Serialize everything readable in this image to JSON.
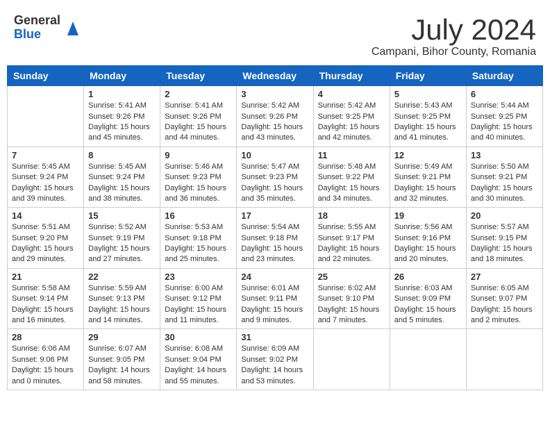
{
  "header": {
    "logo_general": "General",
    "logo_blue": "Blue",
    "month_title": "July 2024",
    "location": "Campani, Bihor County, Romania"
  },
  "days_of_week": [
    "Sunday",
    "Monday",
    "Tuesday",
    "Wednesday",
    "Thursday",
    "Friday",
    "Saturday"
  ],
  "weeks": [
    [
      {
        "day": "",
        "info": ""
      },
      {
        "day": "1",
        "info": "Sunrise: 5:41 AM\nSunset: 9:26 PM\nDaylight: 15 hours\nand 45 minutes."
      },
      {
        "day": "2",
        "info": "Sunrise: 5:41 AM\nSunset: 9:26 PM\nDaylight: 15 hours\nand 44 minutes."
      },
      {
        "day": "3",
        "info": "Sunrise: 5:42 AM\nSunset: 9:26 PM\nDaylight: 15 hours\nand 43 minutes."
      },
      {
        "day": "4",
        "info": "Sunrise: 5:42 AM\nSunset: 9:25 PM\nDaylight: 15 hours\nand 42 minutes."
      },
      {
        "day": "5",
        "info": "Sunrise: 5:43 AM\nSunset: 9:25 PM\nDaylight: 15 hours\nand 41 minutes."
      },
      {
        "day": "6",
        "info": "Sunrise: 5:44 AM\nSunset: 9:25 PM\nDaylight: 15 hours\nand 40 minutes."
      }
    ],
    [
      {
        "day": "7",
        "info": "Sunrise: 5:45 AM\nSunset: 9:24 PM\nDaylight: 15 hours\nand 39 minutes."
      },
      {
        "day": "8",
        "info": "Sunrise: 5:45 AM\nSunset: 9:24 PM\nDaylight: 15 hours\nand 38 minutes."
      },
      {
        "day": "9",
        "info": "Sunrise: 5:46 AM\nSunset: 9:23 PM\nDaylight: 15 hours\nand 36 minutes."
      },
      {
        "day": "10",
        "info": "Sunrise: 5:47 AM\nSunset: 9:23 PM\nDaylight: 15 hours\nand 35 minutes."
      },
      {
        "day": "11",
        "info": "Sunrise: 5:48 AM\nSunset: 9:22 PM\nDaylight: 15 hours\nand 34 minutes."
      },
      {
        "day": "12",
        "info": "Sunrise: 5:49 AM\nSunset: 9:21 PM\nDaylight: 15 hours\nand 32 minutes."
      },
      {
        "day": "13",
        "info": "Sunrise: 5:50 AM\nSunset: 9:21 PM\nDaylight: 15 hours\nand 30 minutes."
      }
    ],
    [
      {
        "day": "14",
        "info": "Sunrise: 5:51 AM\nSunset: 9:20 PM\nDaylight: 15 hours\nand 29 minutes."
      },
      {
        "day": "15",
        "info": "Sunrise: 5:52 AM\nSunset: 9:19 PM\nDaylight: 15 hours\nand 27 minutes."
      },
      {
        "day": "16",
        "info": "Sunrise: 5:53 AM\nSunset: 9:18 PM\nDaylight: 15 hours\nand 25 minutes."
      },
      {
        "day": "17",
        "info": "Sunrise: 5:54 AM\nSunset: 9:18 PM\nDaylight: 15 hours\nand 23 minutes."
      },
      {
        "day": "18",
        "info": "Sunrise: 5:55 AM\nSunset: 9:17 PM\nDaylight: 15 hours\nand 22 minutes."
      },
      {
        "day": "19",
        "info": "Sunrise: 5:56 AM\nSunset: 9:16 PM\nDaylight: 15 hours\nand 20 minutes."
      },
      {
        "day": "20",
        "info": "Sunrise: 5:57 AM\nSunset: 9:15 PM\nDaylight: 15 hours\nand 18 minutes."
      }
    ],
    [
      {
        "day": "21",
        "info": "Sunrise: 5:58 AM\nSunset: 9:14 PM\nDaylight: 15 hours\nand 16 minutes."
      },
      {
        "day": "22",
        "info": "Sunrise: 5:59 AM\nSunset: 9:13 PM\nDaylight: 15 hours\nand 14 minutes."
      },
      {
        "day": "23",
        "info": "Sunrise: 6:00 AM\nSunset: 9:12 PM\nDaylight: 15 hours\nand 11 minutes."
      },
      {
        "day": "24",
        "info": "Sunrise: 6:01 AM\nSunset: 9:11 PM\nDaylight: 15 hours\nand 9 minutes."
      },
      {
        "day": "25",
        "info": "Sunrise: 6:02 AM\nSunset: 9:10 PM\nDaylight: 15 hours\nand 7 minutes."
      },
      {
        "day": "26",
        "info": "Sunrise: 6:03 AM\nSunset: 9:09 PM\nDaylight: 15 hours\nand 5 minutes."
      },
      {
        "day": "27",
        "info": "Sunrise: 6:05 AM\nSunset: 9:07 PM\nDaylight: 15 hours\nand 2 minutes."
      }
    ],
    [
      {
        "day": "28",
        "info": "Sunrise: 6:06 AM\nSunset: 9:06 PM\nDaylight: 15 hours\nand 0 minutes."
      },
      {
        "day": "29",
        "info": "Sunrise: 6:07 AM\nSunset: 9:05 PM\nDaylight: 14 hours\nand 58 minutes."
      },
      {
        "day": "30",
        "info": "Sunrise: 6:08 AM\nSunset: 9:04 PM\nDaylight: 14 hours\nand 55 minutes."
      },
      {
        "day": "31",
        "info": "Sunrise: 6:09 AM\nSunset: 9:02 PM\nDaylight: 14 hours\nand 53 minutes."
      },
      {
        "day": "",
        "info": ""
      },
      {
        "day": "",
        "info": ""
      },
      {
        "day": "",
        "info": ""
      }
    ]
  ]
}
